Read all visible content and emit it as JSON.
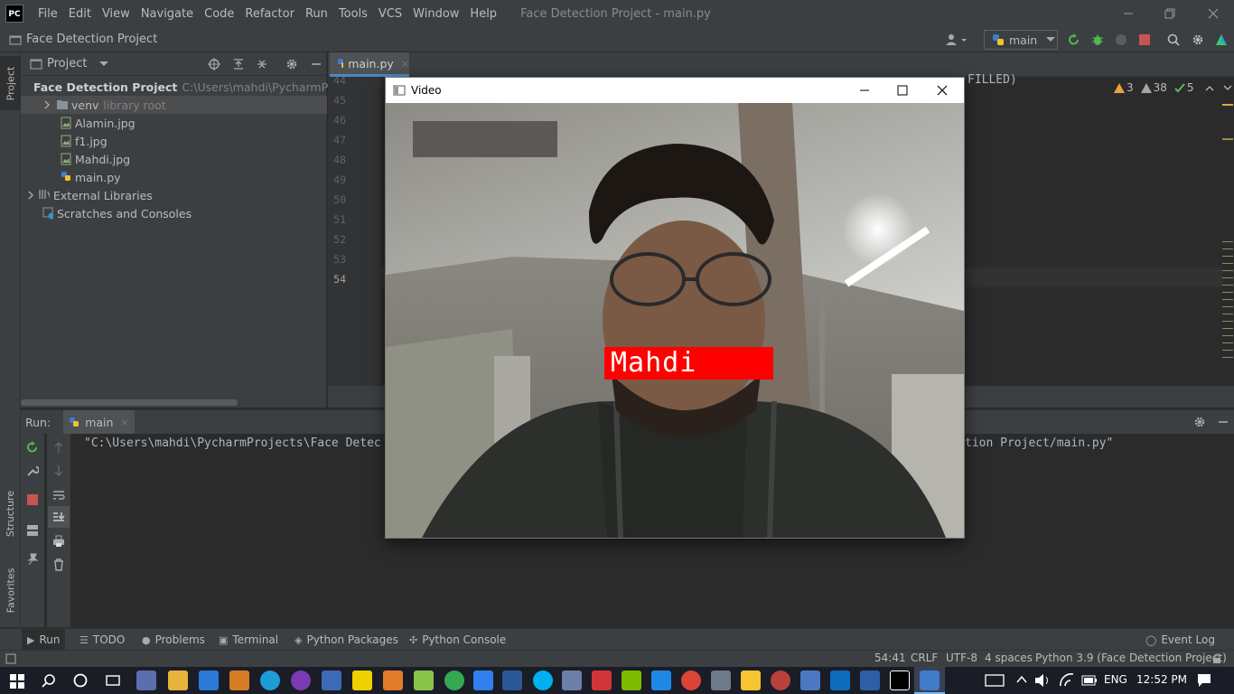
{
  "app": {
    "menu": [
      "File",
      "Edit",
      "View",
      "Navigate",
      "Code",
      "Refactor",
      "Run",
      "Tools",
      "VCS",
      "Window",
      "Help"
    ],
    "window_title": "Face Detection Project - main.py",
    "logo": "PC"
  },
  "navbar": {
    "project_name": "Face Detection Project",
    "run_config": "main"
  },
  "left_strip": {
    "project_tab": "Project",
    "structure_tab": "Structure",
    "favorites_tab": "Favorites"
  },
  "project_panel": {
    "header": "Project",
    "tree": [
      {
        "label": "Face Detection Project",
        "hint": "C:\\Users\\mahdi\\PycharmProjec"
      },
      {
        "label": "venv",
        "hint": "library root"
      },
      {
        "label": "Alamin.jpg"
      },
      {
        "label": "f1.jpg"
      },
      {
        "label": "Mahdi.jpg"
      },
      {
        "label": "main.py"
      },
      {
        "label": "External Libraries"
      },
      {
        "label": "Scratches and Consoles"
      }
    ]
  },
  "editor": {
    "tab": "main.py",
    "line_numbers": [
      "44",
      "45",
      "46",
      "47",
      "48",
      "49",
      "50",
      "51",
      "52",
      "53",
      "54"
    ],
    "visible_code_fragment": "FILLED)",
    "inspections": {
      "warnings_a": "3",
      "warnings_b": "38",
      "ok": "5"
    }
  },
  "run_panel": {
    "label": "Run:",
    "tab": "main",
    "output_left": "\"C:\\Users\\mahdi\\PycharmProjects\\Face Detec",
    "output_right": "tion Project/main.py\""
  },
  "bottom_tabs": [
    "Run",
    "TODO",
    "Problems",
    "Terminal",
    "Python Packages",
    "Python Console"
  ],
  "event_log": "Event Log",
  "status": {
    "position": "54:41",
    "line_sep": "CRLF",
    "encoding": "UTF-8",
    "indent": "4 spaces",
    "interpreter": "Python 3.9 (Face Detection Project)"
  },
  "video_window": {
    "title": "Video",
    "face_label": "Mahdi",
    "label_color": "#ff0000"
  },
  "taskbar": {
    "language": "ENG",
    "time": "12:52 PM"
  }
}
